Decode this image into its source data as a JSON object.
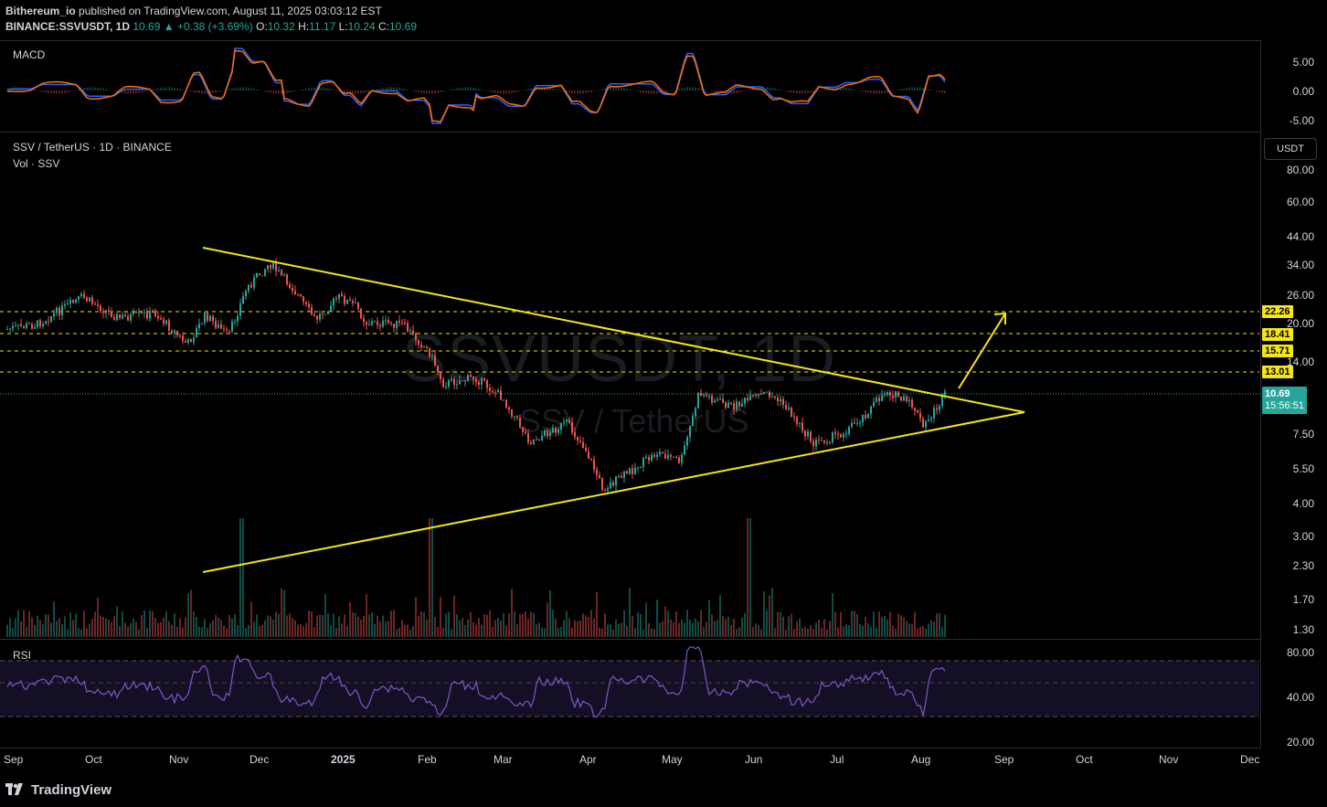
{
  "header": {
    "publisher": "Bithereum_io",
    "published_text": "published on TradingView.com, August 11, 2025 03:03:12 EST",
    "symbol": "BINANCE:SSVUSDT, 1D",
    "last": "10.69",
    "change_arrow": "▲",
    "change": "+0.38 (+3.69%)",
    "o_label": "O:",
    "o": "10.32",
    "h_label": "H:",
    "h": "11.17",
    "l_label": "L:",
    "l": "10.24",
    "c_label": "C:",
    "c": "10.69"
  },
  "macd": {
    "label": "MACD",
    "axis": [
      "5.00",
      "0.00",
      "-5.00"
    ]
  },
  "main": {
    "title": "SSV / TetherUS · 1D · BINANCE",
    "vol_label": "Vol · SSV",
    "currency_button": "USDT",
    "watermark_symbol": "SSVUSDT, 1D",
    "watermark_name": "SSV / TetherUS",
    "axis": [
      "80.00",
      "60.00",
      "44.00",
      "34.00",
      "26.00",
      "20.00",
      "14.00",
      "7.50",
      "5.50",
      "4.00",
      "3.00",
      "2.30",
      "1.70",
      "1.30"
    ],
    "levels": [
      "22.26",
      "18.41",
      "15.71",
      "13.01"
    ],
    "price_tag": "10.69",
    "countdown": "15:56:51"
  },
  "rsi": {
    "label": "RSI",
    "axis": [
      "80.00",
      "40.00",
      "20.00"
    ]
  },
  "time_axis": [
    "Sep",
    "Oct",
    "Nov",
    "Dec",
    "2025",
    "Feb",
    "Mar",
    "Apr",
    "May",
    "Jun",
    "Jul",
    "Aug",
    "Sep",
    "Oct",
    "Nov",
    "Dec"
  ],
  "footer": {
    "brand": "TradingView",
    "logo_icon": "tradingview-logo-icon"
  },
  "colors": {
    "up": "#26a69a",
    "down": "#ef5350",
    "trendline": "#f5e614",
    "macd_line": "#2962ff",
    "signal_line": "#ff6d00",
    "rsi_line": "#7e57c2",
    "background": "#000000"
  }
}
